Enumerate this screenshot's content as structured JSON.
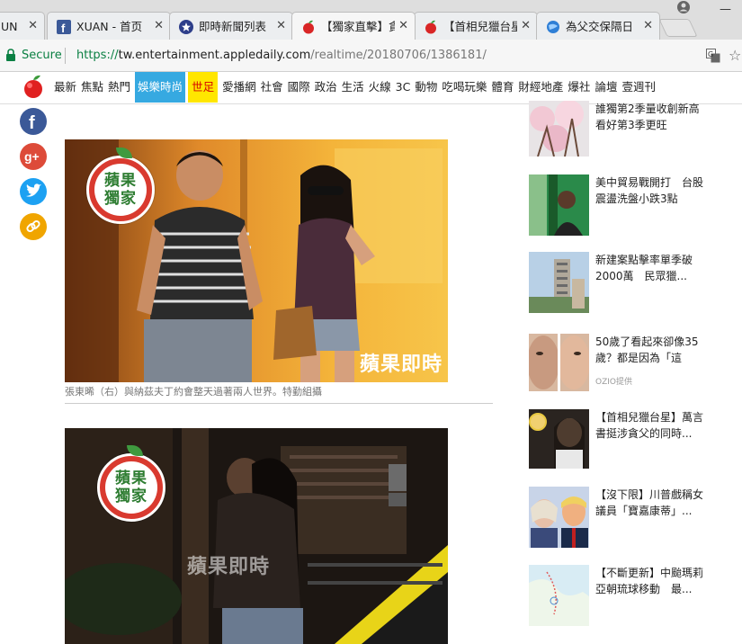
{
  "browser": {
    "tabs": [
      {
        "label": "UN"
      },
      {
        "label": "XUAN - 首页"
      },
      {
        "label": "即時新聞列表"
      },
      {
        "label": "【獨家直擊】貪"
      },
      {
        "label": "【首相兒獵台星"
      },
      {
        "label": "為父交保隔日"
      }
    ],
    "address": {
      "secure_label": "Secure",
      "url_scheme": "https://",
      "url_host": "tw.entertainment.appledaily.com",
      "url_path": "/realtime/20180706/1386181/"
    }
  },
  "nav": {
    "items": [
      "最新",
      "焦點",
      "熱門",
      "娛樂時尚",
      "世足",
      "愛播網",
      "社會",
      "國際",
      "政治",
      "生活",
      "火線",
      "3C",
      "動物",
      "吃喝玩樂",
      "體育",
      "財經地產",
      "爆社",
      "論壇",
      "壹週刊"
    ]
  },
  "article": {
    "photo1": {
      "badge": [
        "蘋果",
        "獨家"
      ],
      "watermark": "蘋果即時",
      "caption": "張東晞（右）與納茲夫丁約會整天過著兩人世界。特勤組攝"
    },
    "photo2": {
      "badge": [
        "蘋果",
        "獨家"
      ],
      "watermark": "蘋果即時"
    }
  },
  "sidebar": {
    "items": [
      {
        "text": "誰獨第2季量收創新高　看好第3季更旺"
      },
      {
        "text": "美中貿易戰開打　台股震盪洗盤小跌3點"
      },
      {
        "text": "新建案點擊率單季破2000萬　民眾獵..."
      },
      {
        "text": "50歲了看起來卻像35歲？都是因為「這",
        "sub": "OZIO提供"
      },
      {
        "text": "【首相兒獵台星】萬言書挺涉貪父的同時..."
      },
      {
        "text": "【沒下限】川普戲稱女議員「寶嘉康蒂」..."
      },
      {
        "text": "【不斷更新】中颱瑪莉亞朝琉球移動　最..."
      }
    ]
  },
  "colors": {
    "nav_blue": "#36a9e1",
    "nav_yellow": "#ffe600",
    "secure_green": "#0b8043",
    "facebook": "#3b5998",
    "google_plus": "#dd4b39",
    "twitter": "#1da1f2",
    "link": "#f0a500"
  }
}
